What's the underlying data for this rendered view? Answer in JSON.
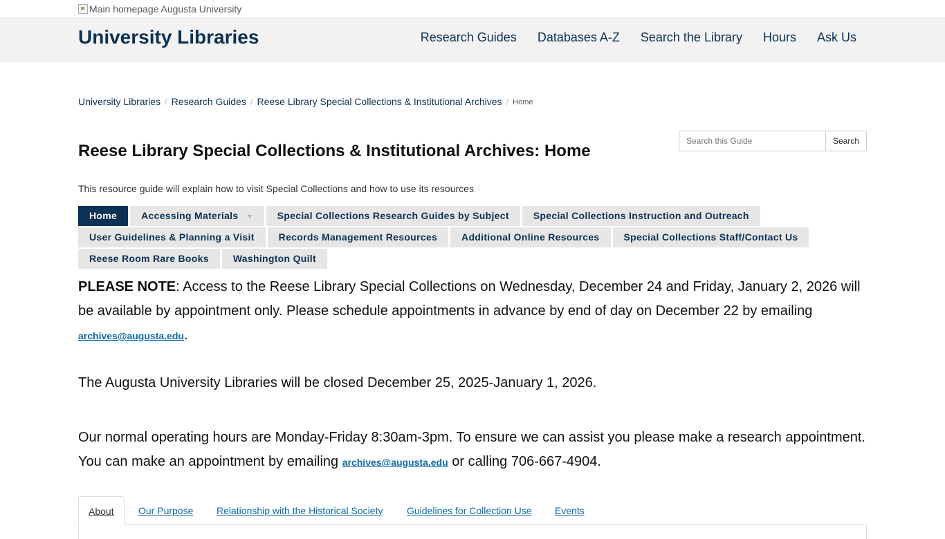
{
  "top_image_alt": "Main homepage Augusta University",
  "header": {
    "brand": "University Libraries",
    "nav": [
      "Research Guides",
      "Databases A-Z",
      "Search the Library",
      "Hours",
      "Ask Us"
    ]
  },
  "breadcrumb": {
    "items": [
      "University Libraries",
      "Research Guides",
      "Reese Library Special Collections & Institutional Archives"
    ],
    "current": "Home",
    "separator": "/"
  },
  "search": {
    "placeholder": "Search this Guide",
    "button": "Search"
  },
  "page": {
    "title": "Reese Library Special Collections & Institutional Archives: Home",
    "description": "This resource guide will explain how to visit Special Collections and how to use its resources"
  },
  "tabs": {
    "row1": [
      "Home",
      "Accessing Materials",
      "Special Collections Research Guides by Subject",
      "Special Collections Instruction and Outreach"
    ],
    "row2": [
      "User Guidelines & Planning a Visit",
      "Records Management Resources",
      "Additional Online Resources",
      "Special Collections Staff/Contact Us"
    ],
    "row3": [
      "Reese Room Rare Books",
      "Washington Quilt"
    ]
  },
  "notice": {
    "bold_lead": "PLEASE NOTE",
    "p1_text": ": Access to the Reese Library Special Collections on Wednesday, December 24 and Friday, January 2, 2026 will be available by appointment only. Please schedule appointments in advance by end of day on December 22 by emailing ",
    "email": "archives@augusta.edu",
    "p1_end": ".",
    "p2": "The Augusta University Libraries will be closed December 25, 2025-January 1, 2026.",
    "p3_text": "Our normal operating hours are Monday-Friday 8:30am-3pm. To ensure we can assist you please make a research appointment. You can make an appointment by emailing ",
    "p3_tail": " or calling 706-667-4904."
  },
  "box_tabs": [
    "About",
    "Our Purpose",
    "Relationship with the Historical Society",
    "Guidelines for Collection Use",
    "Events"
  ],
  "colors": {
    "brand_navy": "#0b3154",
    "link_blue": "#0b6aa7",
    "header_bg": "#f2f2f2",
    "tab_bg": "#e6e6e6"
  }
}
